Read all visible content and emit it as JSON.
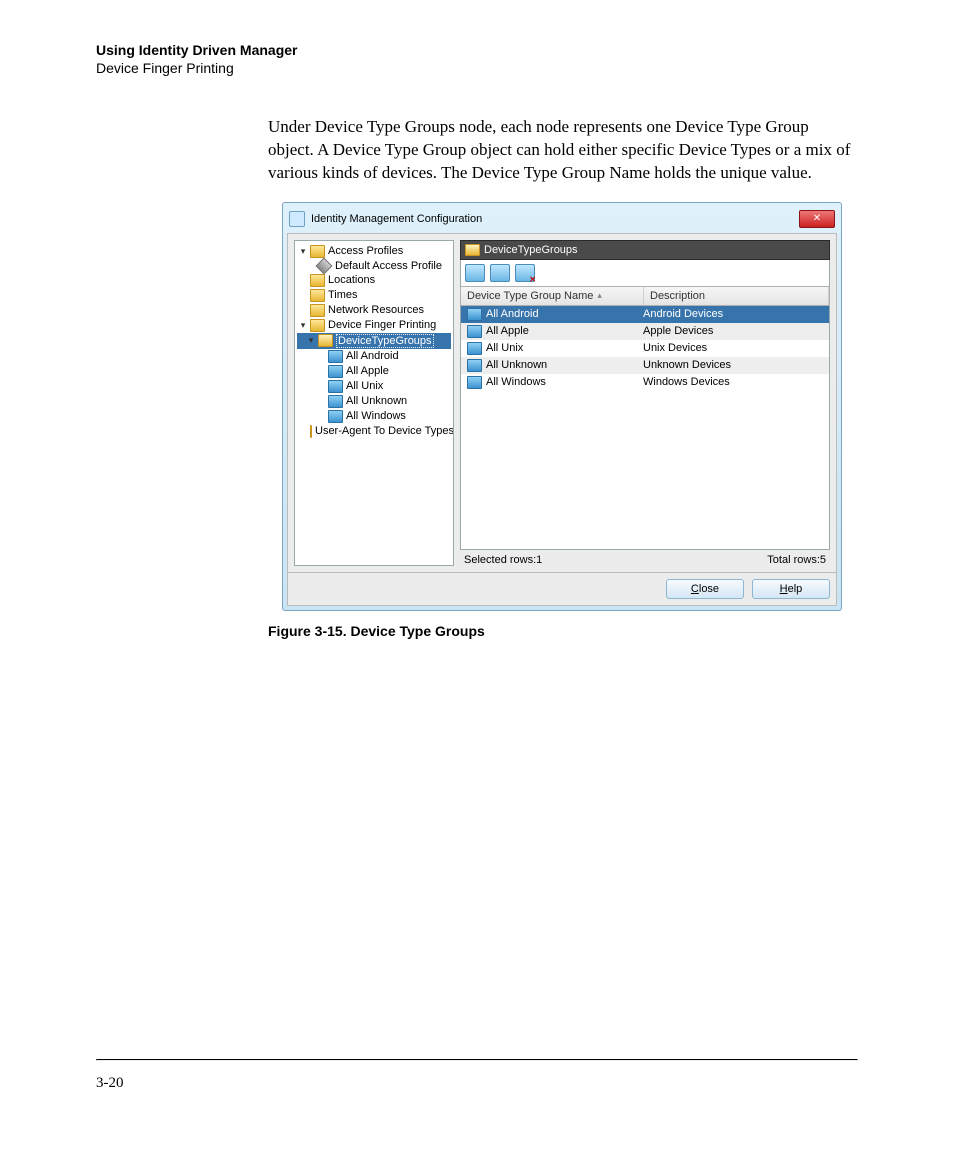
{
  "header": {
    "title": "Using Identity Driven Manager",
    "subtitle": "Device Finger Printing"
  },
  "body_paragraph": "Under Device Type Groups node, each node represents one Device Type Group object. A Device Type Group object can hold either specific Device Types or a mix of various kinds of devices. The Device Type Group Name holds the unique value.",
  "figure_caption": "Figure 3-15. Device Type Groups",
  "page_number": "3-20",
  "dialog": {
    "title": "Identity Management Configuration",
    "tree": [
      {
        "label": "Access Profiles",
        "icon": "folder",
        "indent": 0,
        "expanded": true
      },
      {
        "label": "Default Access Profile",
        "icon": "diamond",
        "indent": 1
      },
      {
        "label": "Locations",
        "icon": "folder",
        "indent": 0
      },
      {
        "label": "Times",
        "icon": "folder",
        "indent": 0
      },
      {
        "label": "Network Resources",
        "icon": "folder",
        "indent": 0
      },
      {
        "label": "Device Finger Printing",
        "icon": "folder",
        "indent": 0,
        "expanded": true
      },
      {
        "label": "DeviceTypeGroups",
        "icon": "folder-open",
        "indent": 1,
        "selected": true,
        "expanded": true
      },
      {
        "label": "All Android",
        "icon": "grp",
        "indent": 2
      },
      {
        "label": "All Apple",
        "icon": "grp",
        "indent": 2
      },
      {
        "label": "All Unix",
        "icon": "grp",
        "indent": 2
      },
      {
        "label": "All Unknown",
        "icon": "grp",
        "indent": 2
      },
      {
        "label": "All Windows",
        "icon": "grp",
        "indent": 2
      },
      {
        "label": "User-Agent To Device Types",
        "icon": "folder",
        "indent": 1
      }
    ],
    "crumb": "DeviceTypeGroups",
    "columns": {
      "name": "Device Type Group Name",
      "desc": "Description"
    },
    "rows": [
      {
        "name": "All Android",
        "desc": "Android Devices",
        "selected": true
      },
      {
        "name": "All Apple",
        "desc": "Apple Devices"
      },
      {
        "name": "All Unix",
        "desc": "Unix Devices"
      },
      {
        "name": "All Unknown",
        "desc": "Unknown Devices"
      },
      {
        "name": "All Windows",
        "desc": "Windows Devices"
      }
    ],
    "selected_rows_label": "Selected rows:1",
    "total_rows_label": "Total rows:5",
    "buttons": {
      "close": "Close",
      "help": "Help"
    }
  }
}
